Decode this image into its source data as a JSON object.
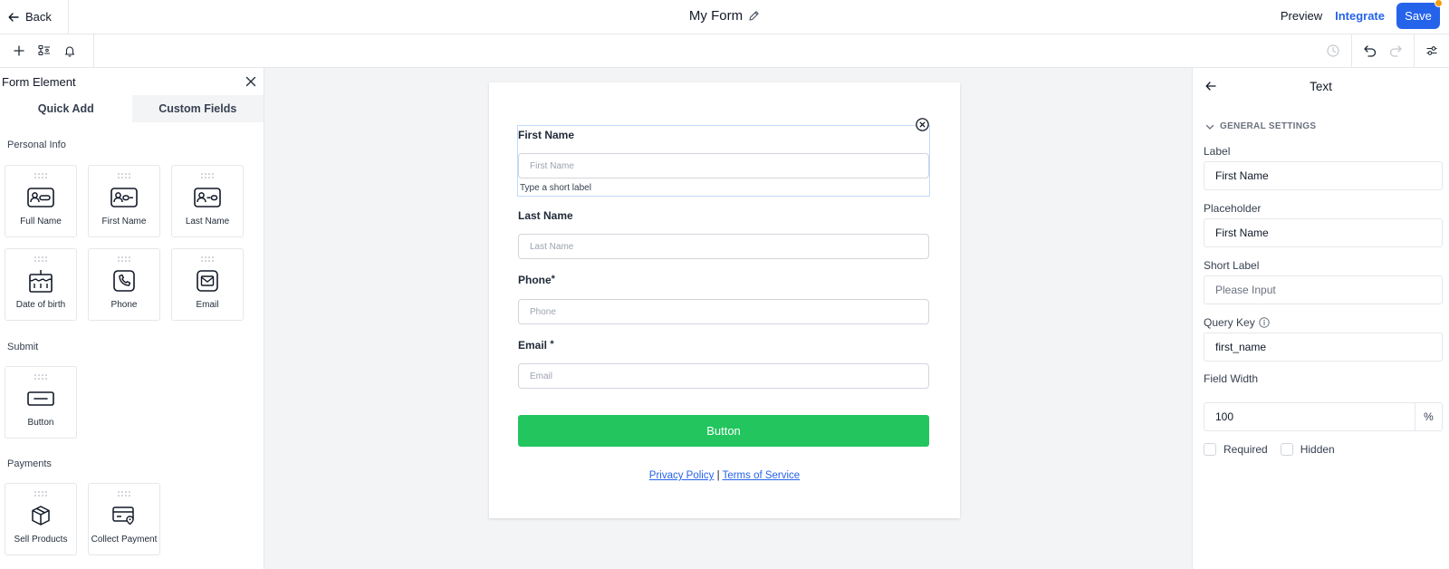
{
  "header": {
    "back_label": "Back",
    "title": "My Form",
    "preview_label": "Preview",
    "integrate_label": "Integrate",
    "save_label": "Save"
  },
  "left_panel": {
    "title": "Form Element",
    "tabs": [
      {
        "label": "Quick Add",
        "active": true
      },
      {
        "label": "Custom Fields",
        "active": false
      }
    ],
    "sections": [
      {
        "title": "Personal Info",
        "items": [
          {
            "label": "Full Name",
            "icon": "id-card-icon"
          },
          {
            "label": "First Name",
            "icon": "id-card-icon"
          },
          {
            "label": "Last Name",
            "icon": "id-card-icon"
          },
          {
            "label": "Date of birth",
            "icon": "cake-icon"
          },
          {
            "label": "Phone",
            "icon": "phone-icon"
          },
          {
            "label": "Email",
            "icon": "mail-icon"
          }
        ]
      },
      {
        "title": "Submit",
        "items": [
          {
            "label": "Button",
            "icon": "button-icon"
          }
        ]
      },
      {
        "title": "Payments",
        "items": [
          {
            "label": "Sell Products",
            "icon": "box-icon"
          },
          {
            "label": "Collect Payment",
            "icon": "card-payment-icon"
          }
        ]
      }
    ]
  },
  "form": {
    "fields": [
      {
        "label": "First Name",
        "placeholder": "First Name",
        "required": false,
        "short_label": "Type a short label"
      },
      {
        "label": "Last Name",
        "placeholder": "Last Name",
        "required": false
      },
      {
        "label": "Phone",
        "placeholder": "Phone",
        "required": true
      },
      {
        "label": "Email",
        "placeholder": "Email",
        "required": true
      }
    ],
    "required_mark": "*",
    "button_label": "Button",
    "privacy_label": "Privacy Policy",
    "separator": "|",
    "terms_label": "Terms of Service"
  },
  "right_panel": {
    "title": "Text",
    "section_title": "GENERAL SETTINGS",
    "label_title": "Label",
    "label_value": "First Name",
    "placeholder_title": "Placeholder",
    "placeholder_value": "First Name",
    "short_label_title": "Short Label",
    "short_label_placeholder": "Please Input",
    "query_key_title": "Query Key",
    "query_key_value": "first_name",
    "field_width_title": "Field Width",
    "field_width_value": "100",
    "field_width_unit": "%",
    "required_label": "Required",
    "hidden_label": "Hidden"
  },
  "colors": {
    "accent": "#2563eb",
    "submit_button": "#22c55e",
    "notification_dot": "#f59e0b"
  }
}
